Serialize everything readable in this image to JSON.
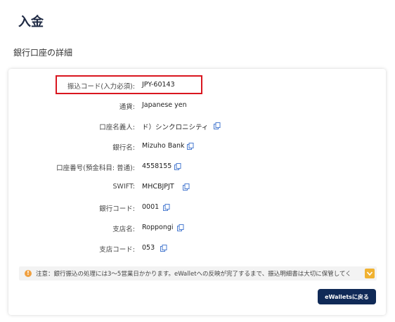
{
  "page": {
    "title": "入金",
    "section_title": "銀行口座の詳細"
  },
  "details": [
    {
      "label": "振込コード(入力必須):",
      "value": "JPY-60143"
    },
    {
      "label": "通貨:",
      "value": "Japanese yen"
    },
    {
      "label": "口座名義人:",
      "value": "ド）シンクロニシティ"
    },
    {
      "label": "銀行名:",
      "value": "Mizuho Bank"
    },
    {
      "label": "口座番号(預金科目: 普通):",
      "value": "4558155"
    },
    {
      "label": "SWIFT:",
      "value": "MHCBJPJT"
    },
    {
      "label": "銀行コード:",
      "value": "0001"
    },
    {
      "label": "支店名:",
      "value": "Roppongi"
    },
    {
      "label": "支店コード:",
      "value": "053"
    }
  ],
  "notice": {
    "text": "注意：銀行振込の処理には3～5営業日かかります。eWalletへの反映が完了するまで、振込明細書は大切に保管してく",
    "info_icon": "info-icon",
    "expand_icon": "chevron-down-icon"
  },
  "actions": {
    "back_label": "eWalletsに戻る"
  },
  "colors": {
    "accent": "#102a57",
    "copy_icon": "#4a7bd0",
    "highlight": "#d9161f",
    "warning": "#f0b232"
  }
}
